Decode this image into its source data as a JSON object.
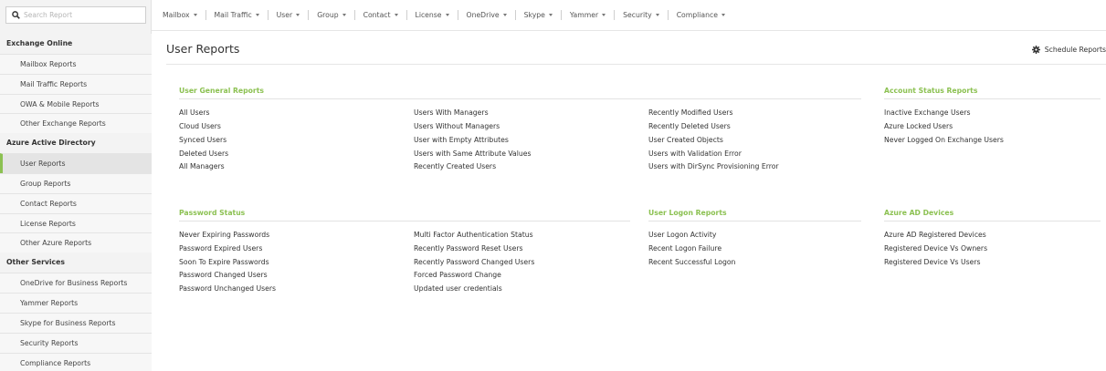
{
  "search": {
    "placeholder": "Search Report"
  },
  "sidebar": {
    "groups": [
      {
        "title": "Exchange Online",
        "items": [
          "Mailbox Reports",
          "Mail Traffic Reports",
          "OWA & Mobile Reports",
          "Other Exchange Reports"
        ]
      },
      {
        "title": "Azure Active Directory",
        "items": [
          "User Reports",
          "Group Reports",
          "Contact Reports",
          "License Reports",
          "Other Azure Reports"
        ]
      },
      {
        "title": "Other Services",
        "items": [
          "OneDrive for Business Reports",
          "Yammer Reports",
          "Skype for Business Reports",
          "Security Reports",
          "Compliance Reports"
        ]
      }
    ],
    "active_item": "User Reports"
  },
  "topnav": {
    "items": [
      "Mailbox",
      "Mail Traffic",
      "User",
      "Group",
      "Contact",
      "License",
      "OneDrive",
      "Skype",
      "Yammer",
      "Security",
      "Compliance"
    ]
  },
  "page": {
    "title": "User Reports",
    "schedule_label": "Schedule Reports"
  },
  "sections": {
    "user_general": {
      "title": "User General Reports",
      "col1": [
        "All Users",
        "Cloud Users",
        "Synced Users",
        "Deleted Users",
        "All Managers"
      ],
      "col2": [
        "Users With Managers",
        "Users Without Managers",
        "User with Empty Attributes",
        "Users with Same Attribute Values",
        "Recently Created Users"
      ],
      "col3": [
        "Recently Modified Users",
        "Recently Deleted Users",
        "User Created Objects",
        "Users with Validation Error",
        "Users with DirSync Provisioning Error"
      ]
    },
    "account_status": {
      "title": "Account Status Reports",
      "col1": [
        "Inactive Exchange Users",
        "Azure Locked Users",
        "Never Logged On Exchange Users"
      ]
    },
    "password_status": {
      "title": "Password Status",
      "col1": [
        "Never Expiring Passwords",
        "Password Expired Users",
        "Soon To Expire Passwords",
        "Password Changed Users",
        "Password Unchanged Users"
      ],
      "col2": [
        "Multi Factor Authentication Status",
        "Recently Password Reset Users",
        "Recently Password Changed Users",
        "Forced Password Change",
        "Updated user credentials"
      ]
    },
    "user_logon": {
      "title": "User Logon Reports",
      "col1": [
        "User Logon Activity",
        "Recent Logon Failure",
        "Recent Successful Logon"
      ]
    },
    "azure_ad_devices": {
      "title": "Azure AD Devices",
      "col1": [
        "Azure AD Registered Devices",
        "Registered Device Vs Owners",
        "Registered Device Vs Users"
      ]
    }
  },
  "colors": {
    "accent": "#8cc152",
    "sidebar_bg": "#f3f3f3"
  },
  "icons": {
    "search": "search-icon",
    "schedule": "gear-icon",
    "caret": "caret-down-icon"
  }
}
